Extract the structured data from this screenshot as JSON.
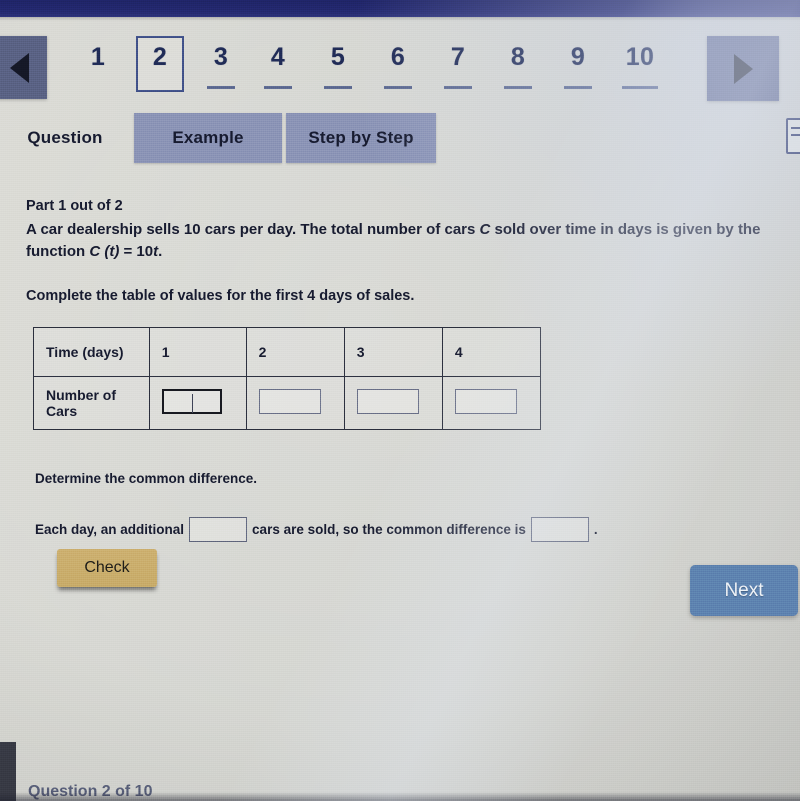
{
  "colors": {
    "page_background": "#d2d3ce",
    "top_band": "#23286d",
    "tab_inactive": "#8891b4",
    "pager_arrow": "#575f80",
    "check_button": "#c6a966",
    "next_button": "#5b7fae",
    "text": "#161a2e"
  },
  "pager": {
    "prev_label": "previous",
    "next_label": "next",
    "current_page": "2",
    "pages": [
      {
        "label": "1",
        "current": false,
        "underlined": false
      },
      {
        "label": "2",
        "current": true,
        "underlined": false
      },
      {
        "label": "3",
        "current": false,
        "underlined": true
      },
      {
        "label": "4",
        "current": false,
        "underlined": true
      },
      {
        "label": "5",
        "current": false,
        "underlined": true
      },
      {
        "label": "6",
        "current": false,
        "underlined": true
      },
      {
        "label": "7",
        "current": false,
        "underlined": true
      },
      {
        "label": "8",
        "current": false,
        "underlined": true
      },
      {
        "label": "9",
        "current": false,
        "underlined": true
      },
      {
        "label": "10",
        "current": false,
        "underlined": true
      }
    ]
  },
  "tabs": [
    {
      "label": "Question",
      "active": true
    },
    {
      "label": "Example",
      "active": false
    },
    {
      "label": "Step by Step",
      "active": false
    }
  ],
  "header_icon": "document-icon",
  "question": {
    "part_label": "Part 1 out of 2",
    "stem_line1": "A car dealership sells 10 cars per day. The total number of cars ",
    "stem_var": "C",
    "stem_line1b": " sold over time in days is given by the",
    "stem_line2a": "function ",
    "stem_fn": "C (t)",
    "stem_line2b": " = 10",
    "stem_t": "t",
    "stem_line2c": ".",
    "instruction": "Complete the table of values for the first 4 days of sales."
  },
  "table": {
    "row_header_1": "Time (days)",
    "row_header_2": "Number of Cars",
    "time_values": [
      "1",
      "2",
      "3",
      "4"
    ],
    "car_inputs": [
      {
        "value": "",
        "focused": true
      },
      {
        "value": "",
        "focused": false
      },
      {
        "value": "",
        "focused": false
      },
      {
        "value": "",
        "focused": false
      }
    ]
  },
  "common_difference": {
    "prompt": "Determine the common difference.",
    "sentence_a": "Each day, an additional",
    "input_1_value": "",
    "sentence_b": "cars are sold, so the common difference is",
    "input_2_value": "",
    "sentence_c": "."
  },
  "buttons": {
    "check_label": "Check",
    "next_label": "Next"
  },
  "footer": {
    "label": "Question 2 of 10"
  }
}
